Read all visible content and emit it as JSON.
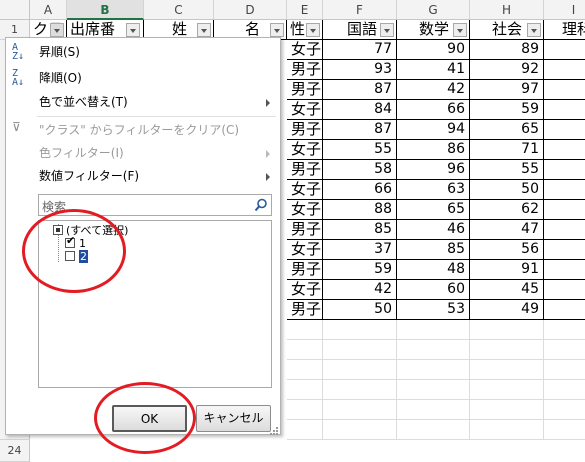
{
  "columns": {
    "letters": [
      "A",
      "B",
      "C",
      "D",
      "E",
      "F",
      "G",
      "H",
      "I"
    ],
    "selected": "B"
  },
  "rows": {
    "first_row_number": "1",
    "last_row_number": "24"
  },
  "header_row": {
    "A": "クラ",
    "B": "出席番",
    "C": "姓",
    "D": "名",
    "E": "性",
    "F": "国語",
    "G": "数学",
    "H": "社会",
    "I": "理科"
  },
  "data_rows": [
    {
      "gender": "女子",
      "kokugo": "77",
      "sugaku": "90",
      "shakai": "89"
    },
    {
      "gender": "男子",
      "kokugo": "93",
      "sugaku": "41",
      "shakai": "92"
    },
    {
      "gender": "男子",
      "kokugo": "87",
      "sugaku": "42",
      "shakai": "97"
    },
    {
      "gender": "女子",
      "kokugo": "84",
      "sugaku": "66",
      "shakai": "59"
    },
    {
      "gender": "男子",
      "kokugo": "87",
      "sugaku": "94",
      "shakai": "65"
    },
    {
      "gender": "女子",
      "kokugo": "55",
      "sugaku": "86",
      "shakai": "71"
    },
    {
      "gender": "男子",
      "kokugo": "58",
      "sugaku": "96",
      "shakai": "55"
    },
    {
      "gender": "女子",
      "kokugo": "66",
      "sugaku": "63",
      "shakai": "50"
    },
    {
      "gender": "女子",
      "kokugo": "88",
      "sugaku": "65",
      "shakai": "62"
    },
    {
      "gender": "男子",
      "kokugo": "85",
      "sugaku": "46",
      "shakai": "47"
    },
    {
      "gender": "女子",
      "kokugo": "37",
      "sugaku": "85",
      "shakai": "56"
    },
    {
      "gender": "男子",
      "kokugo": "59",
      "sugaku": "48",
      "shakai": "91"
    },
    {
      "gender": "女子",
      "kokugo": "42",
      "sugaku": "60",
      "shakai": "45"
    },
    {
      "gender": "男子",
      "kokugo": "50",
      "sugaku": "53",
      "shakai": "49"
    }
  ],
  "filter_menu": {
    "sort_asc": "昇順(S)",
    "sort_desc": "降順(O)",
    "sort_by_color": "色で並べ替え(T)",
    "clear_filter": "\"クラス\" からフィルターをクリア(C)",
    "color_filter": "色フィルター(I)",
    "number_filter": "数値フィルター(F)",
    "search_placeholder": "検索",
    "list_items": [
      {
        "label": "(すべて選択)",
        "state": "partial"
      },
      {
        "label": "1",
        "state": "checked"
      },
      {
        "label": "2",
        "state": "unchecked"
      }
    ],
    "ok_label": "OK",
    "cancel_label": "キャンセル"
  },
  "annotation_color": "#e31c23",
  "accent_color": "#217346"
}
